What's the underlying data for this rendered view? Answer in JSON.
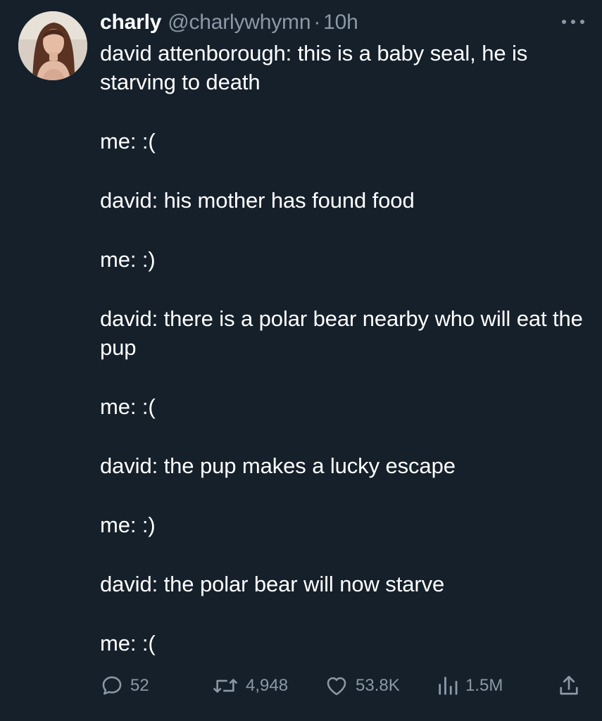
{
  "author": {
    "name": "charly",
    "handle": "@charlywhymn",
    "separator": "·",
    "time": "10h"
  },
  "tweet": {
    "paragraphs": [
      "david attenborough: this is a baby seal, he is starving to death",
      "me: :(",
      "david: his mother has found food",
      "me: :)",
      "david: there is a polar bear nearby who will eat the pup",
      "me: :(",
      "david: the pup makes a lucky escape",
      "me: :)",
      "david: the polar bear will now starve",
      "me: :("
    ]
  },
  "stats": {
    "replies": "52",
    "retweets": "4,948",
    "likes": "53.8K",
    "views": "1.5M"
  },
  "icons": {
    "more": "more-horizontal-icon",
    "reply": "reply-icon",
    "retweet": "retweet-icon",
    "like": "heart-icon",
    "views": "views-chart-icon",
    "share": "share-icon"
  },
  "colors": {
    "background": "#15202b",
    "text": "#ffffff",
    "muted": "#8b98a5"
  }
}
